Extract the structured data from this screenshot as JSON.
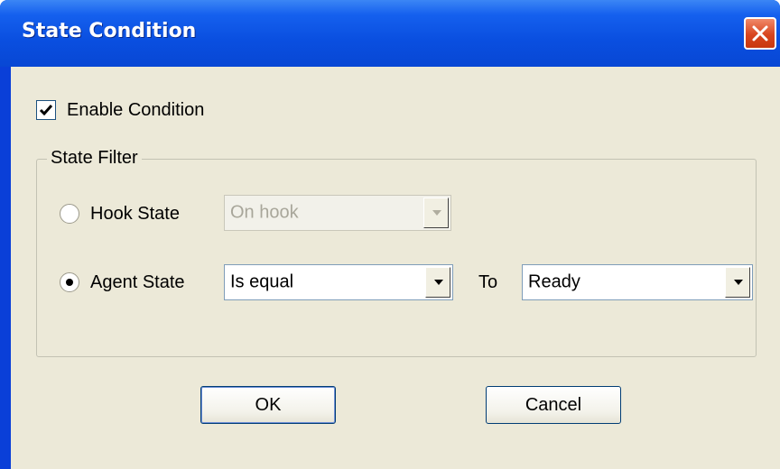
{
  "window": {
    "title": "State Condition"
  },
  "enable_condition": {
    "label": "Enable Condition",
    "checked": true
  },
  "state_filter": {
    "title": "State Filter",
    "hook_state": {
      "label": "Hook State",
      "selected": false,
      "combo_value": "On hook",
      "combo_enabled": false
    },
    "agent_state": {
      "label": "Agent State",
      "selected": true,
      "operator_value": "Is equal",
      "to_label": "To",
      "state_value": "Ready"
    }
  },
  "buttons": {
    "ok": "OK",
    "cancel": "Cancel"
  }
}
